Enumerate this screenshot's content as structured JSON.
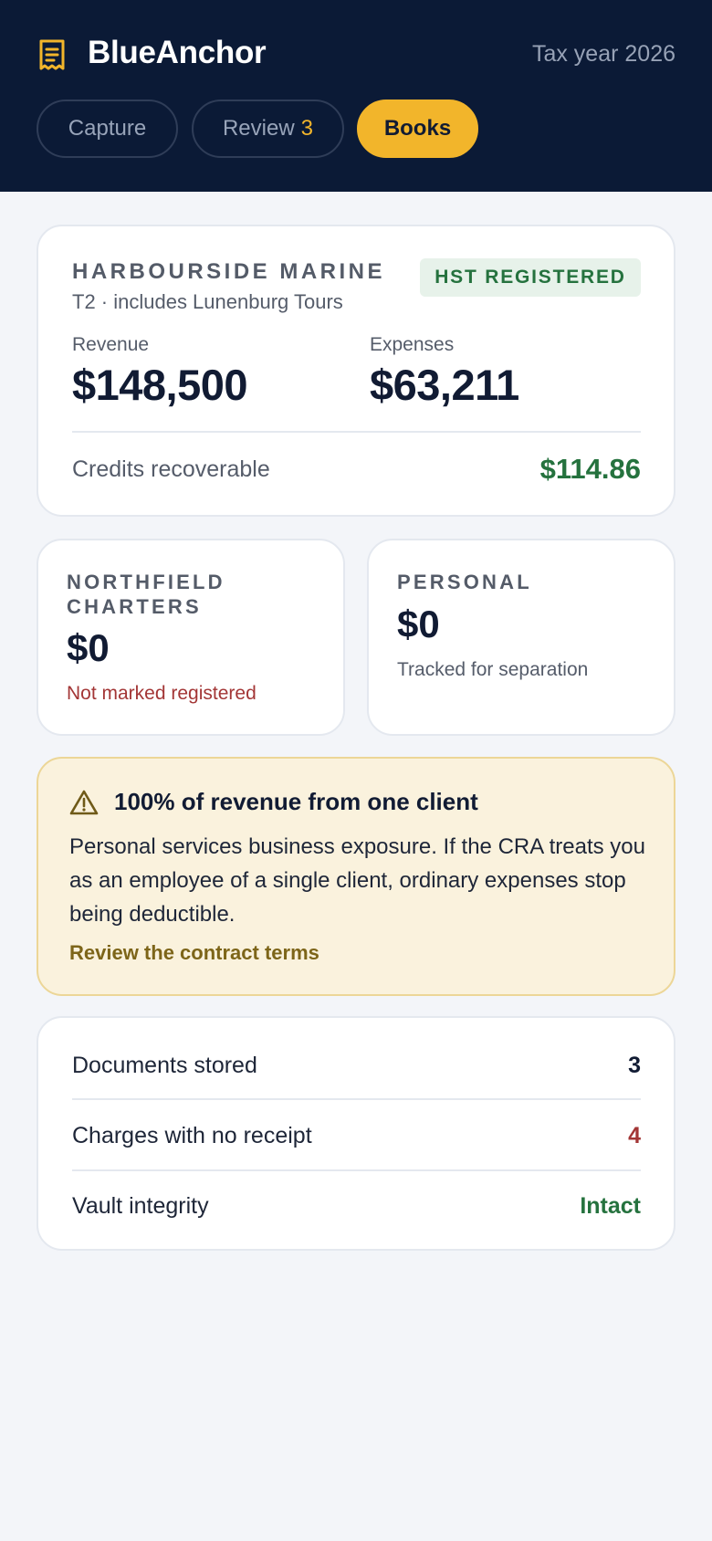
{
  "app": {
    "name": "BlueAnchor",
    "tax_year": "Tax year 2026"
  },
  "tabs": [
    {
      "label": "Capture",
      "count": ""
    },
    {
      "label": "Review",
      "count": "3"
    },
    {
      "label": "Books",
      "count": ""
    }
  ],
  "active_tab": "Books",
  "main_business": {
    "name": "HARBOURSIDE MARINE",
    "subtitle": "T2 · includes Lunenburg Tours",
    "badge": "HST REGISTERED",
    "revenue_label": "Revenue",
    "revenue_value": "$148,500",
    "expenses_label": "Expenses",
    "expenses_value": "$63,211",
    "credits_label": "Credits recoverable",
    "credits_value": "$114.86"
  },
  "secondary_businesses": [
    {
      "name": "NORTHFIELD CHARTERS",
      "value": "$0",
      "note": "Not marked registered"
    },
    {
      "name": "PERSONAL",
      "value": "$0",
      "note": "Tracked for separation"
    }
  ],
  "alert": {
    "title": "100% of revenue from one client",
    "body": "Personal services business exposure. If the CRA treats you as an employee of a single client, ordinary expenses stop being deductible.",
    "link": "Review the contract terms"
  },
  "summary": [
    {
      "label": "Documents stored",
      "value": "3"
    },
    {
      "label": "Charges with no receipt",
      "value": "4"
    },
    {
      "label": "Vault integrity",
      "value": "Intact"
    }
  ],
  "colors": {
    "header_bg": "#0b1a36",
    "accent": "#f2b52b",
    "positive": "#25723e",
    "negative": "#a33636",
    "warning_bg": "#faf2dd"
  },
  "icons": {
    "brand": "receipt-icon",
    "alert": "warning-triangle-icon"
  }
}
